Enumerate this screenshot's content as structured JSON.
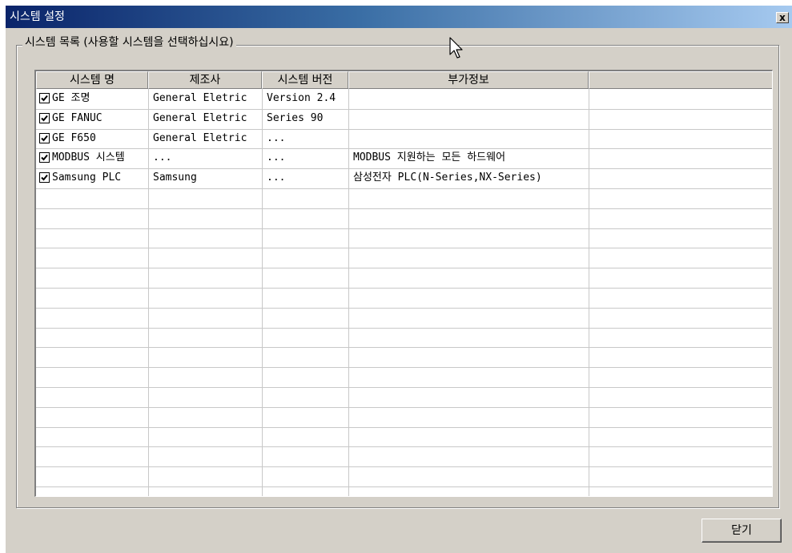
{
  "window": {
    "title": "시스템 설정",
    "close_glyph": "x"
  },
  "group": {
    "label": "시스템 목록 (사용할 시스템을 선택하십시요)"
  },
  "columns": [
    {
      "label": "시스템 명"
    },
    {
      "label": "제조사"
    },
    {
      "label": "시스템 버전"
    },
    {
      "label": "부가정보"
    },
    {
      "label": ""
    }
  ],
  "rows": [
    {
      "checked": true,
      "name": "GE 조명",
      "maker": "General Eletric",
      "version": "Version 2.4",
      "info": ""
    },
    {
      "checked": true,
      "name": "GE FANUC",
      "maker": "General Eletric",
      "version": "Series 90",
      "info": ""
    },
    {
      "checked": true,
      "name": "GE F650",
      "maker": "General Eletric",
      "version": "...",
      "info": ""
    },
    {
      "checked": true,
      "name": "MODBUS 시스템",
      "maker": "...",
      "version": "...",
      "info": "MODBUS 지원하는 모든 하드웨어"
    },
    {
      "checked": true,
      "name": "Samsung PLC",
      "maker": "Samsung",
      "version": "...",
      "info": "삼성전자 PLC(N-Series,NX-Series)"
    }
  ],
  "footer": {
    "close_button_label": "닫기"
  },
  "icons": {
    "close": "close-icon",
    "checkbox": "checkbox-checked-icon",
    "cursor": "mouse-cursor-icon"
  }
}
